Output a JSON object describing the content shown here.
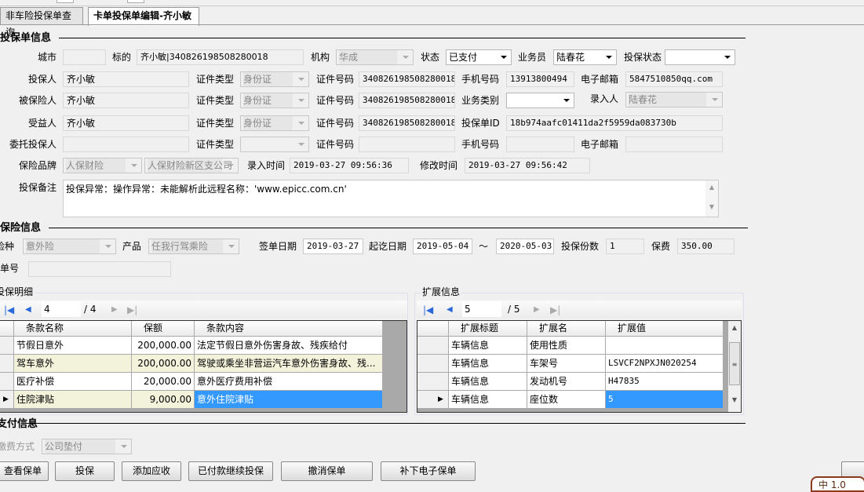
{
  "tabs": [
    {
      "label": "非车险投保单查询"
    },
    {
      "label": "卡单投保单编辑-齐小敏"
    }
  ],
  "policy_section": "投保单信息",
  "row1": {
    "city_label": "城市",
    "city": "",
    "subject_label": "标的",
    "subject": "齐小敏|340826198508280018",
    "org_label": "机构",
    "org": "华成",
    "status_label": "状态",
    "status": "已支付",
    "salesman_label": "业务员",
    "salesman": "陆春花",
    "policy_status_label": "投保状态",
    "policy_status": ""
  },
  "parties": [
    {
      "label": "投保人",
      "name": "齐小敏",
      "id_type_label": "证件类型",
      "id_type": "身份证",
      "id_no_label": "证件号码",
      "id_no": "340826198508280018"
    },
    {
      "label": "被保险人",
      "name": "齐小敏",
      "id_type_label": "证件类型",
      "id_type": "身份证",
      "id_no_label": "证件号码",
      "id_no": "340826198508280018"
    },
    {
      "label": "受益人",
      "name": "齐小敏",
      "id_type_label": "证件类型",
      "id_type": "身份证",
      "id_no_label": "证件号码",
      "id_no": "340826198508280018"
    },
    {
      "label": "委托投保人",
      "name": "",
      "id_type_label": "证件类型",
      "id_type": "",
      "id_no_label": "证件号码",
      "id_no": ""
    }
  ],
  "extra": {
    "phone_label": "手机号码",
    "phone": "13913800494",
    "email_label": "电子邮箱",
    "email": "5847510850qq.com",
    "biz_type_label": "业务类别",
    "biz_type": "",
    "entry_person_label": "录入人",
    "entry_person": "陆春花",
    "policy_id_label": "投保单ID",
    "policy_id": "18b974aafc01411da2f5959da083730b",
    "phone2_label": "手机号码",
    "phone2": "",
    "email2_label": "电子邮箱",
    "email2": ""
  },
  "brand": {
    "label": "保险品牌",
    "brand": "人保财险",
    "branch": "人保财险新区支公司",
    "entry_time_label": "录入时间",
    "entry_time": "2019-03-27 09:56:36",
    "modify_time_label": "修改时间",
    "modify_time": "2019-03-27 09:56:42"
  },
  "remark": {
    "label": "投保备注",
    "value": "投保异常：操作异常：未能解析此远程名称：'www.epicc.com.cn'"
  },
  "insurance_section": "保险信息",
  "insurance": {
    "type_label": "险种",
    "type": "意外险",
    "product_label": "产品",
    "product": "任我行驾乘险",
    "sign_date_label": "签单日期",
    "sign_date": "2019-03-27",
    "period_label": "起讫日期",
    "start": "2019-05-04",
    "tilde": "～",
    "end": "2020-05-03",
    "copies_label": "投保份数",
    "copies": "1",
    "premium_label": "保费",
    "premium": "350.00",
    "policy_no_label": "保单号",
    "policy_no": ""
  },
  "detail": {
    "title": "投保明细",
    "page": "4",
    "total": "/ 4",
    "columns": [
      "条款名称",
      "保额",
      "条款内容"
    ],
    "rows": [
      [
        "节假日意外",
        "200,000.00",
        "法定节假日意外伤害身故、残疾给付"
      ],
      [
        "驾车意外",
        "200,000.00",
        "驾驶或乘坐非营运汽车意外伤害身故、残..."
      ],
      [
        "医疗补偿",
        "20,000.00",
        "意外医疗费用补偿"
      ],
      [
        "住院津贴",
        "9,000.00",
        "意外住院津贴"
      ]
    ]
  },
  "ext": {
    "title": "扩展信息",
    "page": "5",
    "total": "/ 5",
    "columns": [
      "扩展标题",
      "扩展名",
      "扩展值"
    ],
    "rows": [
      [
        "车辆信息",
        "使用性质",
        ""
      ],
      [
        "车辆信息",
        "车架号",
        "LSVCF2NPXJN020254"
      ],
      [
        "车辆信息",
        "发动机号",
        "H47835"
      ],
      [
        "车辆信息",
        "座位数",
        "5"
      ]
    ]
  },
  "payment_section": "支付信息",
  "payment": {
    "method_label": "缴费方式",
    "method": "公司垫付"
  },
  "buttons": [
    "查看保单",
    "投保",
    "添加应收",
    "已付款继续投保",
    "撤消保单",
    "补下电子保单"
  ],
  "ime": "中 1.0",
  "colors": {
    "selection": "#3399ff",
    "alt_row": "#f3f3dc"
  }
}
